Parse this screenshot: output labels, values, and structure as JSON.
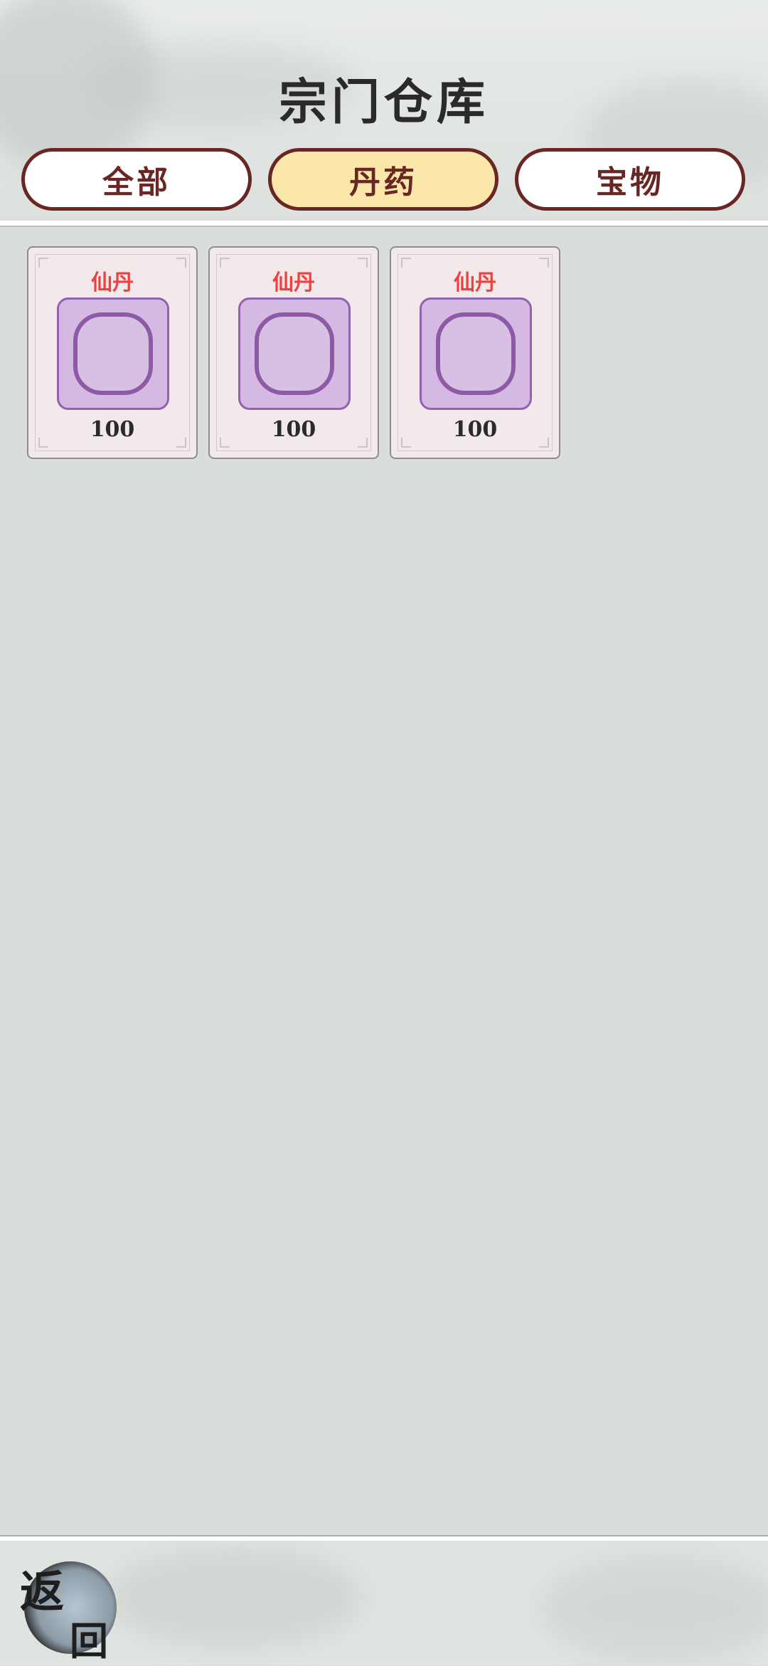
{
  "page": {
    "title": "宗门仓库"
  },
  "tabs": [
    {
      "label": "全部",
      "active": false
    },
    {
      "label": "丹药",
      "active": true
    },
    {
      "label": "宝物",
      "active": false
    }
  ],
  "items": [
    {
      "name": "仙丹",
      "count": "100",
      "icon": "pill-icon"
    },
    {
      "name": "仙丹",
      "count": "100",
      "icon": "pill-icon"
    },
    {
      "name": "仙丹",
      "count": "100",
      "icon": "pill-icon"
    }
  ],
  "footer": {
    "back_label_1": "返",
    "back_label_2": "回"
  },
  "colors": {
    "background": "#d9dedb",
    "tab_border": "#6a2525",
    "tab_active": "#fbe7a9",
    "item_name": "#f04040",
    "item_icon_bg": "#d5b9e2"
  }
}
